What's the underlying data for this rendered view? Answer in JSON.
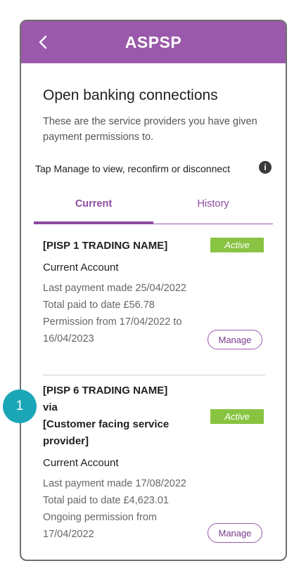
{
  "appbar": {
    "title": "ASPSP",
    "back_icon": "chevron-left-icon"
  },
  "page": {
    "title": "Open banking connections",
    "description": "These are the service providers you have given payment permissions to.",
    "instruction": "Tap Manage to view, reconfirm or disconnect",
    "info_icon_glyph": "i"
  },
  "tabs": [
    {
      "label": "Current",
      "active": true
    },
    {
      "label": "History",
      "active": false
    }
  ],
  "connections": [
    {
      "name": "[PISP 1 TRADING NAME]",
      "status": "Active",
      "account": "Current Account",
      "last_payment": "Last payment made 25/04/2022",
      "total_paid": "Total paid to date  £56.78",
      "permission_line1": "Permission from 17/04/2022 to",
      "permission_line2": "16/04/2023",
      "manage_label": "Manage"
    },
    {
      "name_line1": "[PISP 6 TRADING NAME]",
      "name_line2": "via",
      "name_line3": "[Customer facing service",
      "name_line4": "provider]",
      "status": "Active",
      "account": "Current Account",
      "last_payment": "Last payment made 17/08/2022",
      "total_paid": "Total paid to date  £4,623.01",
      "permission_line1": "Ongoing permission from",
      "permission_line2": "17/04/2022",
      "manage_label": "Manage"
    }
  ],
  "annotation": {
    "step_number": "1"
  },
  "colors": {
    "brand_purple": "#9b59ab",
    "active_green": "#88c441",
    "step_teal": "#1aa6b7"
  }
}
